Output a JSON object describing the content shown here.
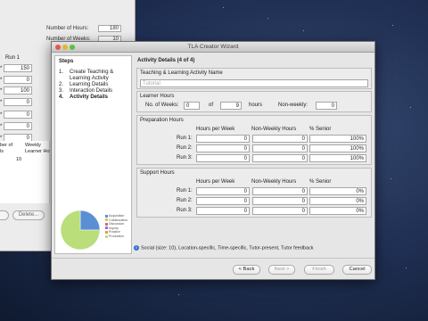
{
  "background_window": {
    "fields": [
      {
        "label": "Number of Hours:",
        "value": "180"
      },
      {
        "label": "Number of Weeks:",
        "value": "10"
      }
    ],
    "run_header": "Run 1",
    "run_values": [
      "150",
      "0",
      "100",
      "0",
      "0",
      "0",
      "0"
    ],
    "run_labels": [
      "*",
      "*",
      "*",
      "*",
      "*",
      "*",
      "*"
    ],
    "table_headers": [
      "ber of\nls",
      "Weekly\nLearner Ho"
    ],
    "table_value": "10",
    "buttons": [
      "",
      "Delete..."
    ]
  },
  "dialog": {
    "title": "TLA Creator Wizard",
    "steps_title": "Steps",
    "steps": [
      {
        "num": "1.",
        "label": "Create Teaching & Learning Activity"
      },
      {
        "num": "2.",
        "label": "Learning Details"
      },
      {
        "num": "3.",
        "label": "Interaction Details"
      },
      {
        "num": "4.",
        "label": "Activity Details"
      }
    ],
    "legend": [
      "Acquisition",
      "Collaboration",
      "Discussion",
      "Inquiry",
      "Practice",
      "Production"
    ],
    "pie": [
      {
        "label": "Acquisition",
        "value": 25,
        "color": "#5b8fd4"
      },
      {
        "label": "Collaboration",
        "value": 0,
        "color": "#e0c060"
      },
      {
        "label": "Discussion",
        "value": 0,
        "color": "#d66a6a"
      },
      {
        "label": "Inquiry",
        "value": 0,
        "color": "#9b72c8"
      },
      {
        "label": "Practice",
        "value": 0,
        "color": "#e49a4b"
      },
      {
        "label": "Production",
        "value": 75,
        "color": "#b9de7a"
      }
    ],
    "content_title": "Activity Details (4 of 4)",
    "tla_name_group": {
      "title": "Teaching & Learning Activity Name",
      "placeholder": "Tutorial"
    },
    "learner_hours": {
      "title": "Learner Hours",
      "weeks_label": "No. of Weeks:",
      "weeks_value": "0",
      "of_label": "of",
      "of_value": "9",
      "hours_label": "hours",
      "nonweekly_label": "Non-weekly:",
      "nonweekly_value": "0"
    },
    "preparation_hours": {
      "title": "Preparation Hours",
      "headers": [
        "Hours per Week",
        "Non-Weekly Hours",
        "% Senior"
      ],
      "rows": [
        {
          "label": "Run 1:",
          "hpw": "0",
          "nwh": "0",
          "senior": "100%"
        },
        {
          "label": "Run 2:",
          "hpw": "0",
          "nwh": "0",
          "senior": "100%"
        },
        {
          "label": "Run 3:",
          "hpw": "0",
          "nwh": "0",
          "senior": "100%"
        }
      ]
    },
    "support_hours": {
      "title": "Support Hours",
      "headers": [
        "Hours per Week",
        "Non-Weekly Hours",
        "% Senior"
      ],
      "rows": [
        {
          "label": "Run 1:",
          "hpw": "0",
          "nwh": "0",
          "senior": "0%"
        },
        {
          "label": "Run 2:",
          "hpw": "0",
          "nwh": "0",
          "senior": "0%"
        },
        {
          "label": "Run 3:",
          "hpw": "0",
          "nwh": "0",
          "senior": "0%"
        }
      ]
    },
    "status_text": "Social (size: 10), Location-specific, Time-specific, Tutor-present, Tutor feedback",
    "buttons": {
      "back": "< Back",
      "next": "Next >",
      "finish": "Finish",
      "cancel": "Cancel"
    }
  }
}
